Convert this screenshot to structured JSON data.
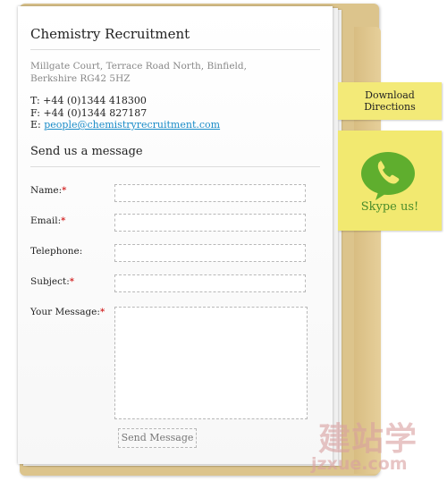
{
  "header": {
    "title": "Chemistry Recruitment"
  },
  "address": {
    "line1": "Millgate Court, Terrace Road North, Binfield,",
    "line2": "Berkshire RG42 5HZ"
  },
  "contact": {
    "telephone": "T: +44 (0)1344 418300",
    "fax": "F: +44 (0)1344 827187",
    "email_prefix": "E: ",
    "email": "people@chemistryrecruitment.com"
  },
  "form": {
    "section_title": "Send us a message",
    "name_label": "Name:",
    "email_label": "Email:",
    "telephone_label": "Telephone:",
    "subject_label": "Subject:",
    "message_label": "Your Message:",
    "required_marker": "*",
    "send_label": "Send Message"
  },
  "notes": {
    "download_line1": "Download",
    "download_line2": "Directions",
    "skype_label": "Skype us!",
    "skype_icon": "skype-phone-bubble-icon"
  },
  "watermark": {
    "big": "建站学",
    "small": "jzxue.com"
  },
  "colors": {
    "folder": "#dcc48c",
    "note": "#f3ea78",
    "link": "#1a8cc8",
    "skype_green": "#5fae2e"
  }
}
